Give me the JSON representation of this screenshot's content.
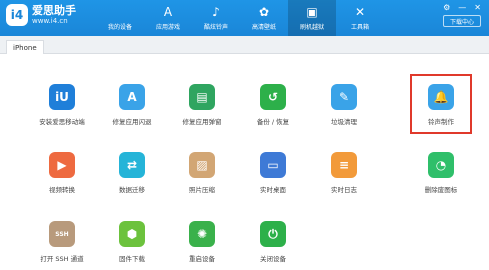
{
  "app": {
    "name": "爱思助手",
    "url": "www.i4.cn",
    "logo_text": "i4"
  },
  "nav": [
    {
      "label": "我的设备",
      "icon": "apple-icon",
      "glyph": ""
    },
    {
      "label": "应用游戏",
      "icon": "app-store-icon",
      "glyph": "A"
    },
    {
      "label": "酷炫铃声",
      "icon": "bell-icon",
      "glyph": "♪"
    },
    {
      "label": "高清壁纸",
      "icon": "wallpaper-icon",
      "glyph": "✿"
    },
    {
      "label": "刷机越狱",
      "icon": "box-icon",
      "glyph": "▣"
    },
    {
      "label": "工具箱",
      "icon": "tools-icon",
      "glyph": "✕"
    }
  ],
  "nav_active_index": 4,
  "download_label": "下载中心",
  "device_tab": "iPhone",
  "tools": [
    {
      "label": "安装爱思移动端",
      "icon": "i4-mobile-icon",
      "color": "#1f7fd9",
      "glyph": "iU"
    },
    {
      "label": "修复应用闪退",
      "icon": "app-repair-icon",
      "color": "#3aa3e8",
      "glyph": "A"
    },
    {
      "label": "修复应用弹窗",
      "icon": "popup-repair-icon",
      "color": "#2fa560",
      "glyph": "▤"
    },
    {
      "label": "备份 / 恢复",
      "icon": "backup-icon",
      "color": "#2db04a",
      "glyph": "↺"
    },
    {
      "label": "垃圾清理",
      "icon": "broom-icon",
      "color": "#3aa3e8",
      "glyph": "✎"
    },
    {
      "label": "铃声制作",
      "icon": "bell-icon",
      "color": "#3aa3e8",
      "glyph": "🔔"
    },
    {
      "label": "视频转换",
      "icon": "video-convert-icon",
      "color": "#ee6a40",
      "glyph": "▶"
    },
    {
      "label": "数据迁移",
      "icon": "data-migrate-icon",
      "color": "#25b4d8",
      "glyph": "⇄"
    },
    {
      "label": "照片压缩",
      "icon": "photo-icon",
      "color": "#d2a674",
      "glyph": "▨"
    },
    {
      "label": "实时桌面",
      "icon": "desktop-icon",
      "color": "#3e7ad6",
      "glyph": "▭"
    },
    {
      "label": "实时日志",
      "icon": "log-icon",
      "color": "#f29a3a",
      "glyph": "≡"
    },
    {
      "label": "删除废图标",
      "icon": "delete-icon-icon",
      "color": "#2fbf6a",
      "glyph": "◔"
    },
    {
      "label": "打开 SSH 通道",
      "icon": "ssh-icon",
      "color": "#b89a7c",
      "glyph": "SSH"
    },
    {
      "label": "固件下载",
      "icon": "firmware-icon",
      "color": "#6cc23d",
      "glyph": "⬢"
    },
    {
      "label": "重启设备",
      "icon": "restart-icon",
      "color": "#3ab14b",
      "glyph": "✺"
    },
    {
      "label": "关闭设备",
      "icon": "power-icon",
      "color": "#2db04a",
      "glyph": "⏻"
    }
  ]
}
